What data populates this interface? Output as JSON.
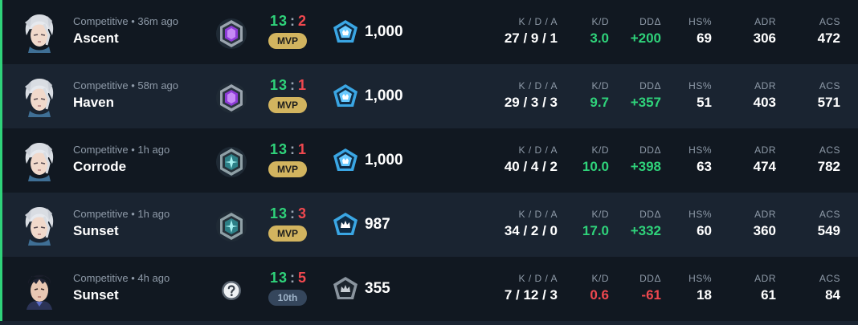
{
  "colors": {
    "win_accent": "#2fd27a",
    "loss_text": "#f0484f",
    "mvp_badge": "#d2b45f",
    "placement_badge": "#35465c",
    "row_dark": "#111821",
    "row_light": "#1a2431"
  },
  "stat_labels": {
    "kda": "K / D / A",
    "kd": "K/D",
    "dd": "DDΔ",
    "hs": "HS%",
    "adr": "ADR",
    "acs": "ACS"
  },
  "matches": [
    {
      "agent_icon": "jett-agent-icon",
      "queue_time": "Competitive • 36m ago",
      "map": "Ascent",
      "rank_icon": "ascendant-rank-icon",
      "score_won": "13",
      "score_sep": ":",
      "score_lost": "2",
      "badge": "MVP",
      "badge_kind": "mvp",
      "rr_icon": "radiant-rr-icon",
      "rr": "1,000",
      "kda": "27 / 9 / 1",
      "kd": "3.0",
      "kd_color": "green",
      "dd": "+200",
      "dd_color": "green",
      "hs": "69",
      "adr": "306",
      "acs": "472"
    },
    {
      "agent_icon": "jett-agent-icon",
      "queue_time": "Competitive • 58m ago",
      "map": "Haven",
      "rank_icon": "ascendant-rank-icon",
      "score_won": "13",
      "score_sep": ":",
      "score_lost": "1",
      "badge": "MVP",
      "badge_kind": "mvp",
      "rr_icon": "radiant-rr-icon",
      "rr": "1,000",
      "kda": "29 / 3 / 3",
      "kd": "9.7",
      "kd_color": "green",
      "dd": "+357",
      "dd_color": "green",
      "hs": "51",
      "adr": "403",
      "acs": "571"
    },
    {
      "agent_icon": "jett-agent-icon",
      "queue_time": "Competitive • 1h ago",
      "map": "Corrode",
      "rank_icon": "immortal-rank-icon",
      "score_won": "13",
      "score_sep": ":",
      "score_lost": "1",
      "badge": "MVP",
      "badge_kind": "mvp",
      "rr_icon": "radiant-rr-icon",
      "rr": "1,000",
      "kda": "40 / 4 / 2",
      "kd": "10.0",
      "kd_color": "green",
      "dd": "+398",
      "dd_color": "green",
      "hs": "63",
      "adr": "474",
      "acs": "782"
    },
    {
      "agent_icon": "jett-agent-icon",
      "queue_time": "Competitive • 1h ago",
      "map": "Sunset",
      "rank_icon": "immortal-rank-icon",
      "score_won": "13",
      "score_sep": ":",
      "score_lost": "3",
      "badge": "MVP",
      "badge_kind": "mvp",
      "rr_icon": "crown-rr-icon",
      "rr": "987",
      "kda": "34 / 2 / 0",
      "kd": "17.0",
      "kd_color": "green",
      "dd": "+332",
      "dd_color": "green",
      "hs": "60",
      "adr": "360",
      "acs": "549"
    },
    {
      "agent_icon": "yoru-agent-icon",
      "queue_time": "Competitive • 4h ago",
      "map": "Sunset",
      "rank_icon": "unknown-rank-icon",
      "score_won": "13",
      "score_sep": ":",
      "score_lost": "5",
      "badge": "10th",
      "badge_kind": "place",
      "rr_icon": "crown-rr-icon-gray",
      "rr": "355",
      "kda": "7 / 12 / 3",
      "kd": "0.6",
      "kd_color": "red",
      "dd": "-61",
      "dd_color": "red",
      "hs": "18",
      "adr": "61",
      "acs": "84"
    }
  ]
}
